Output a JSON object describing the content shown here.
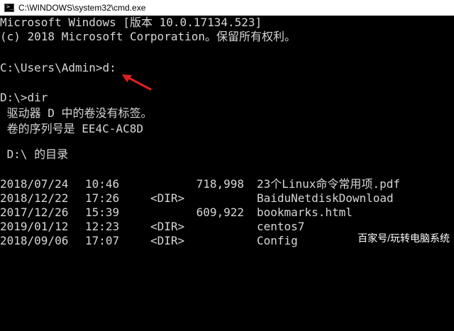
{
  "window": {
    "title": "C:\\WINDOWS\\system32\\cmd.exe",
    "icon": "cmd-icon"
  },
  "console": {
    "lines": [
      "Microsoft Windows [版本 10.0.17134.523]",
      "(c) 2018 Microsoft Corporation。保留所有权利。",
      "",
      "C:\\Users\\Admin>d:",
      "",
      "D:\\>dir",
      " 驱动器 D 中的卷没有标签。",
      " 卷的序列号是 EE4C-AC8D",
      "",
      " D:\\ 的目录",
      ""
    ],
    "entries": [
      {
        "date": "2018/07/24",
        "time": "10:46",
        "dir": "",
        "size": "718,998",
        "name": "23个Linux命令常用项.pdf"
      },
      {
        "date": "2018/12/22",
        "time": "17:26",
        "dir": "<DIR>",
        "size": "",
        "name": "BaiduNetdiskDownload"
      },
      {
        "date": "2017/12/26",
        "time": "15:39",
        "dir": "",
        "size": "609,922",
        "name": "bookmarks.html"
      },
      {
        "date": "2019/01/12",
        "time": "12:23",
        "dir": "<DIR>",
        "size": "",
        "name": "centos7"
      },
      {
        "date": "2018/09/06",
        "time": "17:07",
        "dir": "<DIR>",
        "size": "",
        "name": "Config"
      }
    ]
  },
  "annotation": {
    "arrow_color": "#e02020"
  },
  "watermark": "百家号/玩转电脑系统",
  "colors": {
    "console_bg": "#000000",
    "console_text": "#d6d6d6",
    "titlebar_bg": "#ffffff"
  }
}
